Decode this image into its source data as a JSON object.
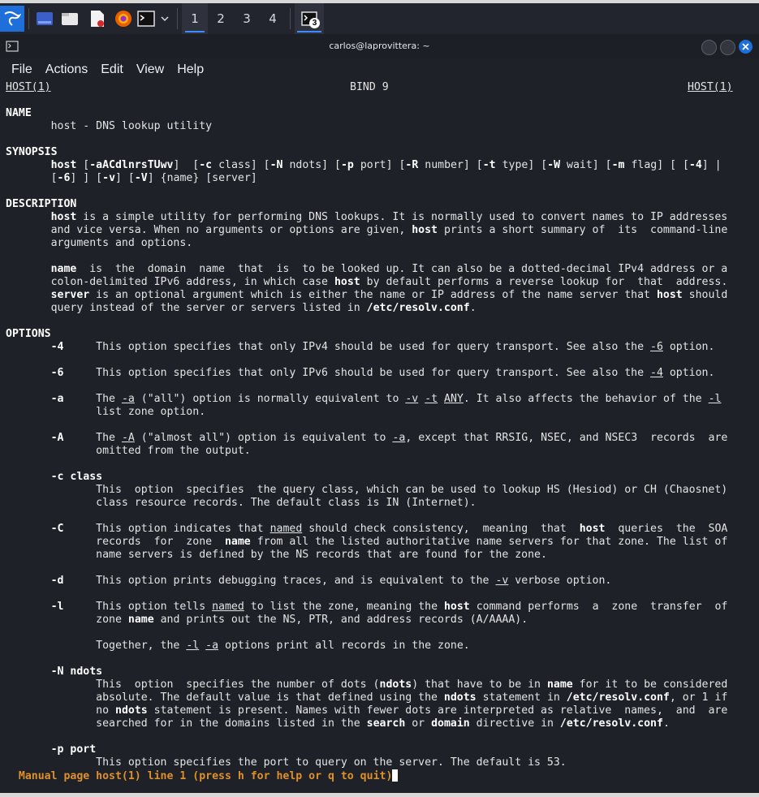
{
  "taskbar": {
    "workspaces": [
      "1",
      "2",
      "3",
      "4"
    ],
    "terminal_badge": "3"
  },
  "window": {
    "title": "carlos@laprovittera: ~",
    "menu": [
      "File",
      "Actions",
      "Edit",
      "View",
      "Help"
    ]
  },
  "man": {
    "header_left": "HOST(1)",
    "header_center": "BIND 9",
    "header_right": "HOST(1)",
    "name_heading": "NAME",
    "name_text": "host - DNS lookup utility",
    "synopsis_heading": "SYNOPSIS",
    "syn1_cmd": "host",
    "syn1_opts": "-aACdlnrsTUwv",
    "syn1_c": "-c",
    "syn1_c_arg": "class",
    "syn1_N": "-N",
    "syn1_N_arg": "ndots",
    "syn1_p": "-p",
    "syn1_p_arg": "port",
    "syn1_R": "-R",
    "syn1_R_arg": "number",
    "syn1_t": "-t",
    "syn1_t_arg": "type",
    "syn1_W": "-W",
    "syn1_W_arg": "wait",
    "syn1_m": "-m",
    "syn1_m_arg": "flag",
    "syn1_4": "-4",
    "syn2_6": "-6",
    "syn2_v": "-v",
    "syn2_V": "-V",
    "syn2_rest": "{name} [server]",
    "description_heading": "DESCRIPTION",
    "d1_host": "host",
    "d1_a": "is a simple utility for performing DNS lookups. It is normally used to convert names to IP addresses",
    "d2_a": "and vice versa. When no arguments or options are given,",
    "d2_host": "host",
    "d2_b": "prints a short summary of  its  command-line",
    "d3": "arguments and options.",
    "d4_name": "name",
    "d4_a": "is  the  domain  name  that  is  to be looked up. It can also be a dotted-decimal IPv4 address or a",
    "d5_a": "colon-delimited IPv6 address, in which case",
    "d5_host": "host",
    "d5_b": "by default performs a reverse lookup for  that  address.",
    "d6_server": "server",
    "d6_a": "is an optional argument which is either the name or IP address of the name server that",
    "d6_host": "host",
    "d6_b": "should",
    "d7_a": "query instead of the server or servers listed in",
    "d7_file": "/etc/resolv.conf",
    "d7_b": ".",
    "options_heading": "OPTIONS",
    "o4_flag": "-4",
    "o4_a": "This option specifies that only IPv4 should be used for query transport. See also the",
    "o4_ref": "-6",
    "o4_b": "option.",
    "o6_flag": "-6",
    "o6_a": "This option specifies that only IPv6 should be used for query transport. See also the",
    "o6_ref": "-4",
    "o6_b": "option.",
    "oa_flag": "-a",
    "oa_a": "The",
    "oa_ref1": "-a",
    "oa_b": "(\"all\") option is normally equivalent to",
    "oa_ref2": "-v",
    "oa_ref3": "-t",
    "oa_ref4": "ANY",
    "oa_c": ". It also affects the behavior of the",
    "oa_ref5": "-l",
    "oa_d": "list zone option.",
    "oA_flag": "-A",
    "oA_a": "The",
    "oA_ref1": "-A",
    "oA_b": "(\"almost all\") option is equivalent to",
    "oA_ref2": "-a",
    "oA_c": ", except that RRSIG, NSEC, and NSEC3  records  are",
    "oA_d": "omitted from the output.",
    "oc_flag": "-c",
    "oc_arg": "class",
    "oc_a": "This  option  specifies  the query class, which can be used to lookup HS (Hesiod) or CH (Chaosnet)",
    "oc_b": "class resource records. The default class is IN (Internet).",
    "oC_flag": "-C",
    "oC_a": "This option indicates that",
    "oC_ref1": "named",
    "oC_b": "should check consistency,  meaning  that",
    "oC_host": "host",
    "oC_c": "queries  the  SOA",
    "oC_d": "records  for  zone",
    "oC_name": "name",
    "oC_e": "from all the listed authoritative name servers for that zone. The list of",
    "oC_f": "name servers is defined by the NS records that are found for the zone.",
    "od_flag": "-d",
    "od_a": "This option prints debugging traces, and is equivalent to the",
    "od_ref": "-v",
    "od_b": "verbose option.",
    "ol_flag": "-l",
    "ol_a": "This option tells",
    "ol_ref": "named",
    "ol_b": "to list the zone, meaning the",
    "ol_host": "host",
    "ol_c": "command performs  a  zone  transfer  of",
    "ol_d": "zone",
    "ol_name": "name",
    "ol_e": "and prints out the NS, PTR, and address records (A/AAAA).",
    "ol_f": "Together, the",
    "ol_ref2": "-l",
    "ol_ref3": "-a",
    "ol_g": "options print all records in the zone.",
    "oN_flag": "-N",
    "oN_arg": "ndots",
    "oN_a": "This  option  specifies the number of dots (",
    "oN_ndots": "ndots",
    "oN_b": ") that have to be in",
    "oN_name": "name",
    "oN_c": "for it to be considered",
    "oN_d": "absolute. The default value is that defined using the",
    "oN_ndots2": "ndots",
    "oN_e": "statement in",
    "oN_file": "/etc/resolv.conf",
    "oN_f": ", or 1 if",
    "oN_g": "no",
    "oN_ndots3": "ndots",
    "oN_h": "statement is present. Names with fewer dots are interpreted as relative  names,  and  are",
    "oN_i": "searched for in the domains listed in the",
    "oN_search": "search",
    "oN_j": "or",
    "oN_domain": "domain",
    "oN_k": "directive in",
    "oN_file2": "/etc/resolv.conf",
    "oN_l": ".",
    "op_flag": "-p",
    "op_arg": "port",
    "op_a": "This option specifies the port to query on the server. The default is 53."
  },
  "status_line": "Manual page host(1) line 1 (press h for help or q to quit)",
  "colors": {
    "terminal_bg": "#1e2127",
    "status_text": "#e0902a",
    "close_button": "#1e6fd9",
    "accent": "#3c8cff"
  }
}
